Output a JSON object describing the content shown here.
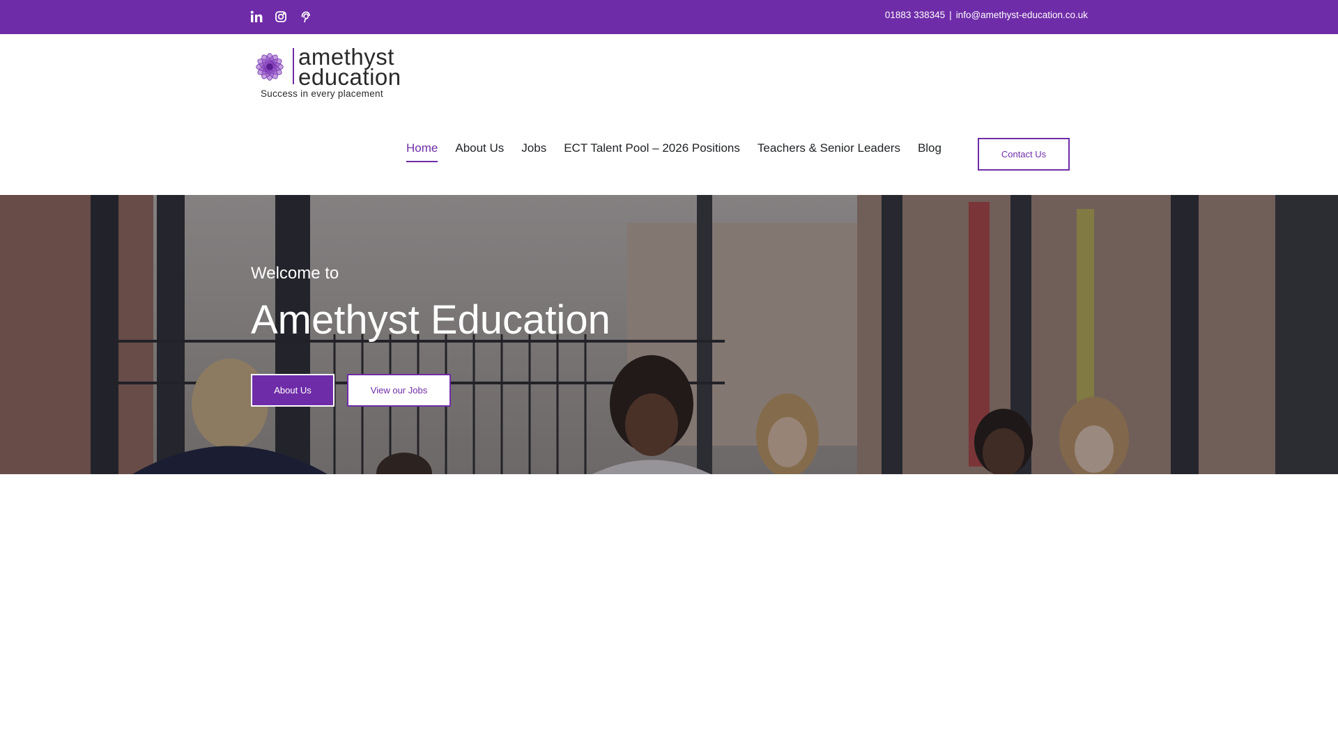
{
  "topbar": {
    "social_icons": [
      "linkedin-icon",
      "instagram-icon",
      "pinterest-icon"
    ],
    "phone": "01883 338345",
    "separator": "|",
    "email": "info@amethyst-education.co.uk"
  },
  "logo": {
    "line1": "amethyst",
    "line2": "education",
    "tagline": "Success in every placement"
  },
  "nav": {
    "items": [
      {
        "label": "Home",
        "active": true
      },
      {
        "label": "About Us"
      },
      {
        "label": "Jobs"
      },
      {
        "label": "ECT Talent Pool – 2026 Positions"
      },
      {
        "label": "Teachers & Senior Leaders"
      },
      {
        "label": "Blog"
      }
    ],
    "contact_button": "Contact Us"
  },
  "hero": {
    "pre_title": "Welcome to",
    "title": "Amethyst Education",
    "primary_button": "About Us",
    "secondary_button": "View our Jobs"
  },
  "colors": {
    "brand": "#6f2ca8",
    "text": "#212326",
    "white": "#ffffff"
  }
}
